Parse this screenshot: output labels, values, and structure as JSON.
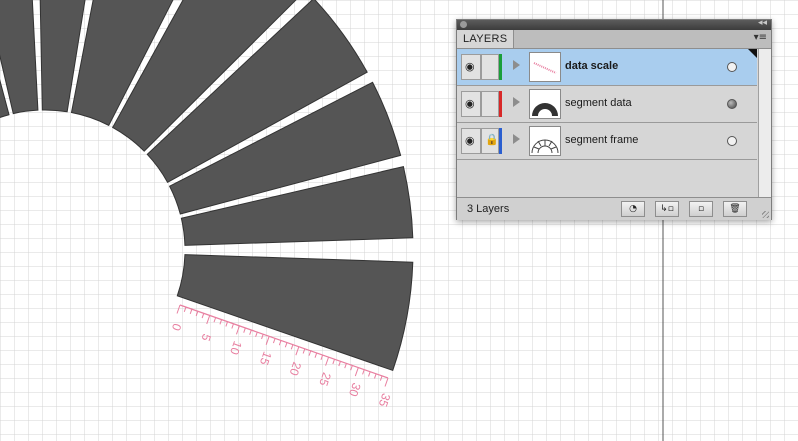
{
  "canvas": {
    "grid_color": "#d4d4d4",
    "segment_fill": "#555555",
    "segment_stroke": "#333333",
    "scale_color": "#e87fa0",
    "scale_labels": [
      "0",
      "5",
      "10",
      "15",
      "20",
      "25",
      "30",
      "35"
    ]
  },
  "layers_panel": {
    "tab_label": "LAYERS",
    "collapse_glyph": "◂◂",
    "menu_glyph": "▾≡",
    "layers": [
      {
        "name": "data scale",
        "selected": true,
        "color": "#1a9e3a",
        "visible": true,
        "locked": false,
        "target": "empty"
      },
      {
        "name": "segment data",
        "selected": false,
        "color": "#d82828",
        "visible": true,
        "locked": false,
        "target": "filled"
      },
      {
        "name": "segment frame",
        "selected": false,
        "color": "#2b5fd0",
        "visible": true,
        "locked": true,
        "target": "empty"
      }
    ],
    "footer": {
      "count_label": "3 Layers",
      "buttons": [
        "make-clipping-mask",
        "create-sublayer",
        "new-layer",
        "delete"
      ]
    }
  }
}
